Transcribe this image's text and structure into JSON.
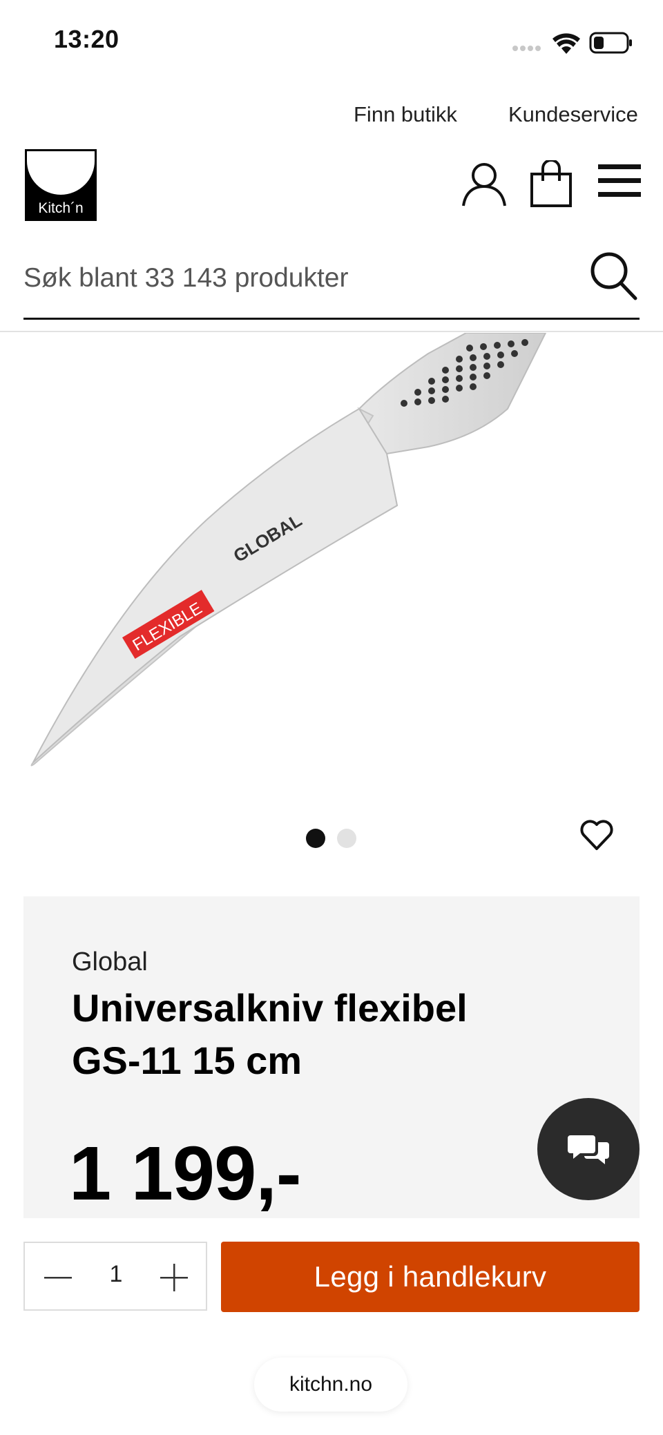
{
  "status_bar": {
    "time": "13:20"
  },
  "top_links": {
    "find_store": "Finn butikk",
    "customer_service": "Kundeservice"
  },
  "logo": {
    "text": "Kitch´n"
  },
  "search": {
    "placeholder": "Søk blant 33 143 produkter"
  },
  "product_image": {
    "badge_text": "FLEXIBLE",
    "brand_etching": "GLOBAL",
    "badge_color": "#e32b2b"
  },
  "carousel": {
    "total": 2,
    "active_index": 0
  },
  "product": {
    "brand": "Global",
    "title": "Universalkniv flexibel GS-11 15 cm",
    "price": "1 199,-"
  },
  "quantity": {
    "value": "1"
  },
  "cart": {
    "add_label": "Legg i handlekurv",
    "button_color": "#d04400"
  },
  "browser": {
    "url": "kitchn.no"
  },
  "icons": {
    "user": "user-icon",
    "bag": "shopping-bag-icon",
    "menu": "hamburger-menu-icon",
    "search": "search-icon",
    "heart": "heart-icon",
    "chat": "chat-icon"
  }
}
